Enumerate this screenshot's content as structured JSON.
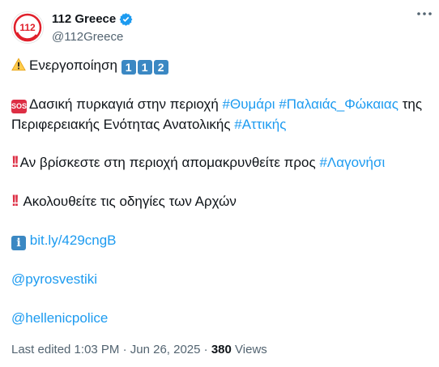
{
  "user": {
    "display_name": "112 Greece",
    "handle": "@112Greece",
    "avatar_text": "112",
    "verified_icon": "verified-badge-icon"
  },
  "tweet": {
    "line1_text": "Ενεργοποίηση",
    "line1_keycaps": [
      "1",
      "1",
      "2"
    ],
    "line2_prefix": "Δασική πυρκαγιά στην περιοχή",
    "line2_tag1": "#Θυμάρι",
    "line2_tag2": "#Παλαιάς_Φώκαιας",
    "line2_suffix": "της",
    "line3_text": "Περιφερειακής Ενότητας Ανατολικής",
    "line3_tag": "#Αττικής",
    "line4_text": "Αν βρίσκεστε στη περιοχή απομακρυνθείτε προς",
    "line4_tag": "#Λαγονήσι",
    "line5_text": "Ακολουθείτε τις οδηγίες των Αρχών",
    "link": "bit.ly/429cngB",
    "mention1": "@pyrosvestiki",
    "mention2": "@hellenicpolice",
    "sos_label": "SOS",
    "info_label": "i"
  },
  "meta": {
    "edited": "Last edited 1:03 PM · Jun 26, 2025 ·",
    "views_count": "380",
    "views_label": "Views"
  },
  "colors": {
    "link": "#1d9bf0",
    "keycap": "#3b88c3",
    "sos": "#dd2e44",
    "verified": "#1d9bf0"
  }
}
